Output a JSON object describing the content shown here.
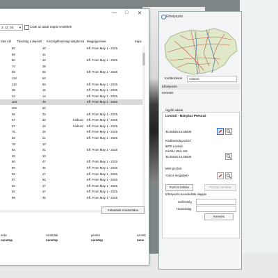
{
  "main": {
    "date_value": "3. 11. 03.",
    "only_today_label": "Csak az adott napra rendeltek",
    "columns": [
      "rtási idő",
      "Távolság a depótól",
      "Kiszolgálhatósági tulajdonsá",
      "Megjegyzések",
      "Kapc"
    ],
    "rows": [
      {
        "a": "80",
        "b": "40",
        "c": "",
        "d": "Eff. From May 1 - 2025",
        "sel": false
      },
      {
        "a": "88",
        "b": "41",
        "c": "",
        "d": "",
        "sel": false
      },
      {
        "a": "80",
        "b": "40",
        "c": "",
        "d": "Eff. From May 1 - 2025",
        "sel": false
      },
      {
        "a": "74",
        "b": "38",
        "c": "",
        "d": "",
        "sel": false
      },
      {
        "a": "98",
        "b": "65",
        "c": "",
        "d": "Eff. From May 1 - 2025",
        "sel": false
      },
      {
        "a": "114",
        "b": "64",
        "c": "",
        "d": "",
        "sel": false
      },
      {
        "a": "110",
        "b": "63",
        "c": "",
        "d": "Eff. From May 1 - 2025",
        "sel": false
      },
      {
        "a": "38",
        "b": "16",
        "c": "",
        "d": "Eff. From May 1 - 2025",
        "sel": false
      },
      {
        "a": "43",
        "b": "14",
        "c": "",
        "d": "Eff. From May 1 - 2025",
        "sel": false
      },
      {
        "a": "104",
        "b": "49",
        "c": "",
        "d": "Eff. From May 1 - 2025",
        "sel": true
      },
      {
        "a": "101",
        "b": "50",
        "c": "",
        "d": "",
        "sel": false
      },
      {
        "a": "65",
        "b": "33",
        "c": "",
        "d": "Eff. From May 1 - 2025",
        "sel": false
      },
      {
        "a": "67",
        "b": "33",
        "c": "Kisbusz",
        "d": "Eff. From May 1 - 2025",
        "sel": false
      },
      {
        "a": "67",
        "b": "33",
        "c": "Kisbusz",
        "d": "Eff. From May 1 - 2025",
        "sel": false
      },
      {
        "a": "75",
        "b": "32",
        "c": "",
        "d": "Eff. From May 1 - 2025",
        "sel": false
      },
      {
        "a": "58",
        "b": "21",
        "c": "",
        "d": "Eff. From May 1 - 2025",
        "sel": false
      },
      {
        "a": "78",
        "b": "40",
        "c": "",
        "d": "",
        "sel": false
      },
      {
        "a": "84",
        "b": "41",
        "c": "",
        "d": "Eff. From May 1 - 2025",
        "sel": false
      },
      {
        "a": "40",
        "b": "13",
        "c": "",
        "d": "",
        "sel": false
      },
      {
        "a": "90",
        "b": "47",
        "c": "",
        "d": "Eff. From May 1 - 2025",
        "sel": false
      },
      {
        "a": "90",
        "b": "46",
        "c": "",
        "d": "Eff. From May 1 - 2025",
        "sel": false
      },
      {
        "a": "92",
        "b": "47",
        "c": "",
        "d": "Eff. From May 1 - 2025",
        "sel": false
      },
      {
        "a": "97",
        "b": "50",
        "c": "",
        "d": "Eff. From May 1 - 2025",
        "sel": false
      },
      {
        "a": "92",
        "b": "47",
        "c": "",
        "d": "Eff. From May 1 - 2025",
        "sel": false
      },
      {
        "a": "92",
        "b": "47",
        "c": "",
        "d": "Eff. From May 1 - 2025",
        "sel": false
      },
      {
        "a": "99",
        "b": "45",
        "c": "",
        "d": "Eff. From May 1 - 2025",
        "sel": false
      }
    ],
    "task_button": "Feladatok módosítása",
    "lower_columns": [
      "erda",
      "csütörtök",
      "péntek",
      "szomb"
    ],
    "lower_values": [
      "nonstop",
      "nonstop",
      "nonstop",
      "nons"
    ]
  },
  "location": {
    "title": "Elhelyezés",
    "region_label": "Korlátozások",
    "region_value": "<nincs>",
    "tab_placement": "Elhelyezés",
    "tab_search": "Keresés",
    "customer_label": "Ügyfél adatai",
    "customer_name": "Lovászi - Bányász Presszó",
    "customer_coords": "46.55526-16.55645",
    "selected_label": "Kiválasztott pozíció",
    "selected_zip": "8878 Lovászi",
    "selected_street": "Kórház Utca 116",
    "selected_coords": "46.55526-16.55645",
    "saved_label": "Mért pozíció",
    "saved_value": "<nincs megadva>",
    "delete_button": "Pozíció törlése",
    "restore_button": "Pozíció mentése",
    "coord_search_label": "Elhelyezés koordináták alapján",
    "lat_label": "Szélesség",
    "lon_label": "Hosszúság",
    "search_button": "Keresés"
  }
}
